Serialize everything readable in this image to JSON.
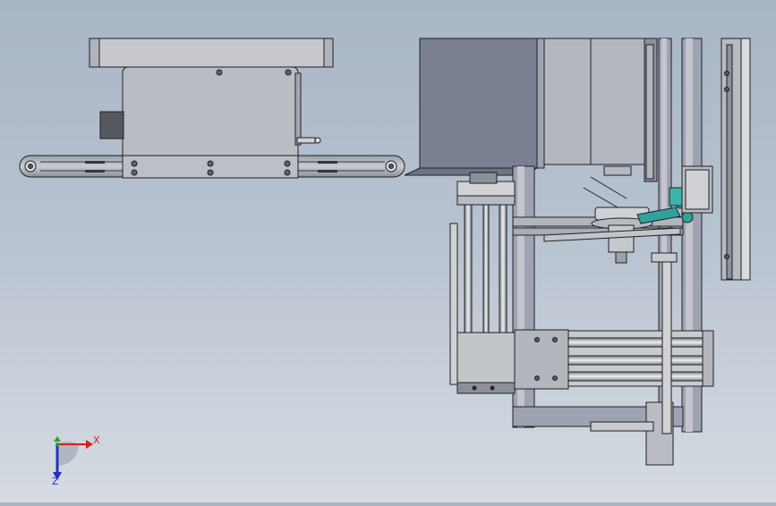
{
  "viewport": {
    "background_top": "#a9b6c6",
    "background_bottom": "#d6dbe2"
  },
  "triad": {
    "x_label": "X",
    "z_label": "Z",
    "x_color": "#d42020",
    "y_color": "#2aa02a",
    "z_color": "#2030c8"
  },
  "colors": {
    "steel": "#c8cace",
    "steel_dark": "#8c9098",
    "frame": "#9ea3b2",
    "motor": "#7a7f92",
    "outline": "#1e2026",
    "accent_teal": "#2fa39a"
  }
}
